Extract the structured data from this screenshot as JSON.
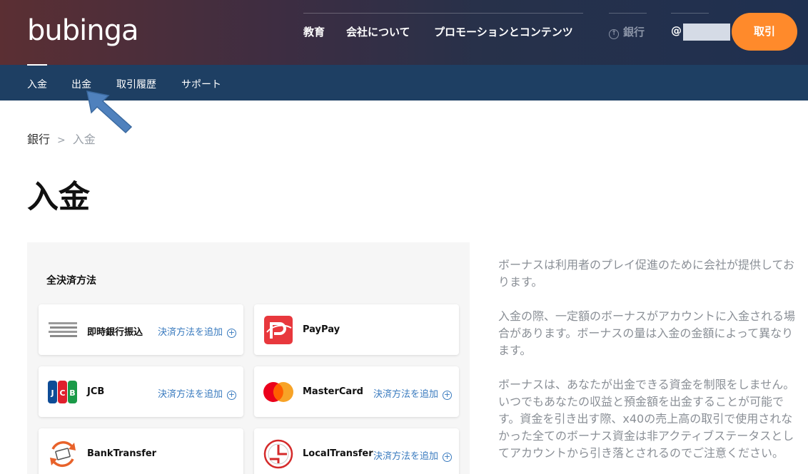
{
  "header": {
    "logo": "bubinga",
    "nav": [
      "教育",
      "会社について",
      "プロモーションとコンテンツ"
    ],
    "bank": "銀行",
    "user_prefix": "@",
    "trade_label": "取引"
  },
  "subnav": [
    "入金",
    "出金",
    "取引履歴",
    "サポート"
  ],
  "breadcrumb": {
    "root": "銀行",
    "sep": ">",
    "current": "入金"
  },
  "page_title": "入金",
  "panel": {
    "title": "全決済方法",
    "add_label": "決済方法を追加",
    "methods": [
      {
        "name": "即時銀行振込",
        "show_add": true
      },
      {
        "name": "PayPay",
        "show_add": false
      },
      {
        "name": "JCB",
        "show_add": true
      },
      {
        "name": "MasterCard",
        "show_add": true
      },
      {
        "name": "BankTransfer",
        "show_add": false
      },
      {
        "name": "LocalTransfer",
        "show_add": true
      }
    ]
  },
  "info": [
    "ボーナスは利用者のプレイ促進のために会社が提供しております。",
    "入金の際、一定額のボーナスがアカウントに入金される場合があります。ボーナスの量は入金の金額によって異なります。",
    "ボーナスは、あなたが出金できる資金を制限をしません。いつでもあなたの収益と預金額を出金することが可能です。資金を引き出す際、x40の売上高の取引で使用されなかった全てのボーナス資金は非アクティブステータスとしてアカウントから引き落とされるのでご注意ください。"
  ],
  "colors": {
    "subnav_bg": "#1e3f63",
    "accent_orange": "#ff8a2b",
    "link_blue": "#3a7bbf"
  }
}
